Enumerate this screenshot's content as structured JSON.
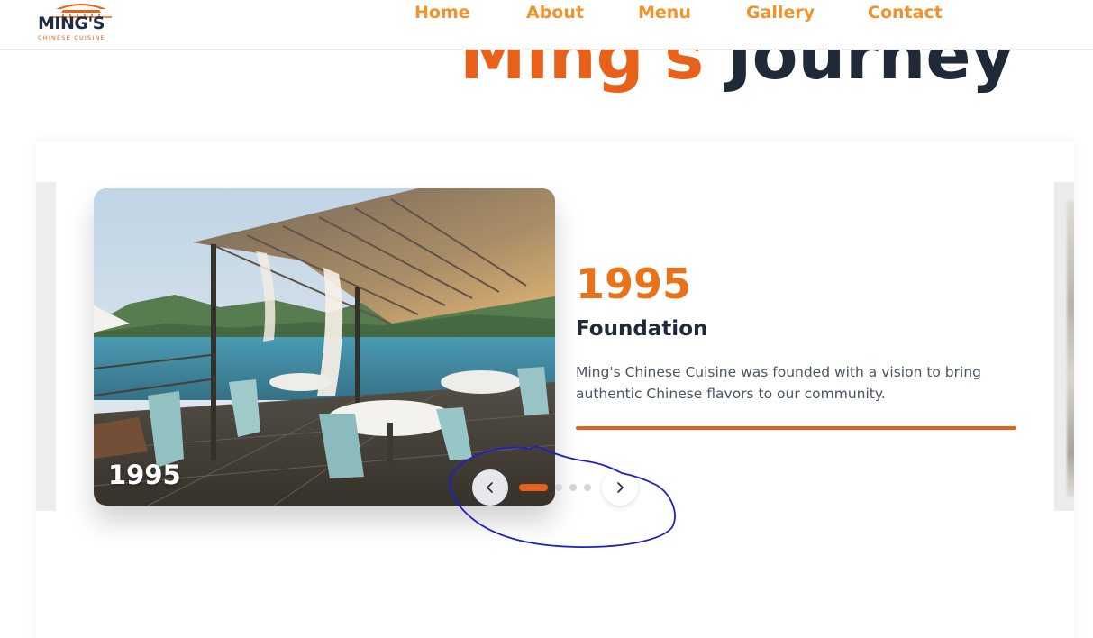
{
  "brand": {
    "name": "MING'S",
    "tagline": "CHINESE CUISINE"
  },
  "nav": {
    "items": [
      {
        "label": "Home"
      },
      {
        "label": "About"
      },
      {
        "label": "Menu"
      },
      {
        "label": "Gallery"
      },
      {
        "label": "Contact"
      }
    ]
  },
  "section": {
    "title_accent": "Ming's",
    "title_rest": "Journey"
  },
  "slide": {
    "photo_year": "1995",
    "year": "1995",
    "title": "Foundation",
    "description": "Ming's Chinese Cuisine was founded with a vision to bring authentic Chinese flavors to our community."
  },
  "carousel": {
    "prev_icon": "chevron-left-icon",
    "next_icon": "chevron-right-icon",
    "dot_count": 4,
    "active_index": 0
  },
  "colors": {
    "accent": "#e8611a",
    "nav_link": "#f0932b",
    "heading_dark": "#1f2937",
    "annotation": "#1f1fc8"
  }
}
